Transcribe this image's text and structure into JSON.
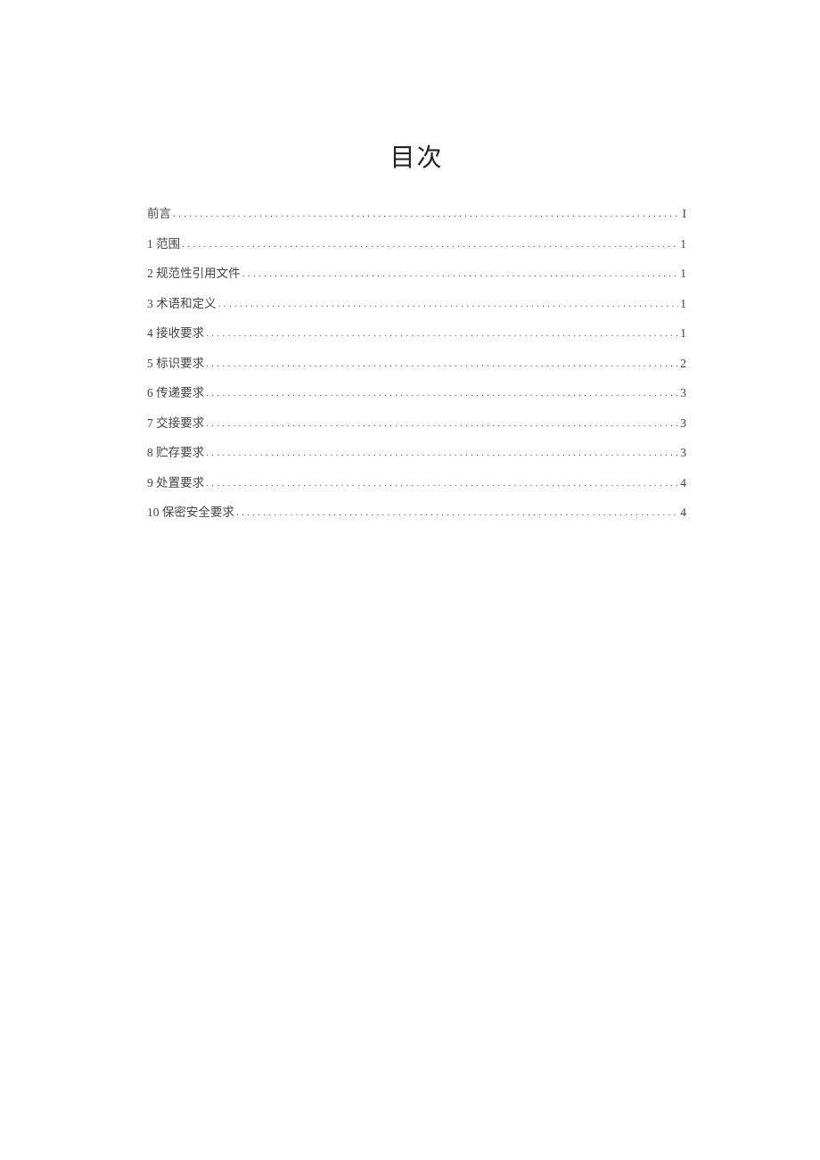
{
  "title": "目次",
  "toc": [
    {
      "label": "前言",
      "page": "I"
    },
    {
      "label": "1 范围",
      "page": "1"
    },
    {
      "label": "2 规范性引用文件",
      "page": "1"
    },
    {
      "label": "3 术语和定义",
      "page": "1"
    },
    {
      "label": "4 接收要求",
      "page": "1"
    },
    {
      "label": "5 标识要求",
      "page": "2"
    },
    {
      "label": "6 传递要求",
      "page": "3"
    },
    {
      "label": "7 交接要求",
      "page": "3"
    },
    {
      "label": "8 贮存要求",
      "page": "3"
    },
    {
      "label": "9 处置要求",
      "page": "4"
    },
    {
      "label": "10 保密安全要求",
      "page": "4"
    }
  ]
}
